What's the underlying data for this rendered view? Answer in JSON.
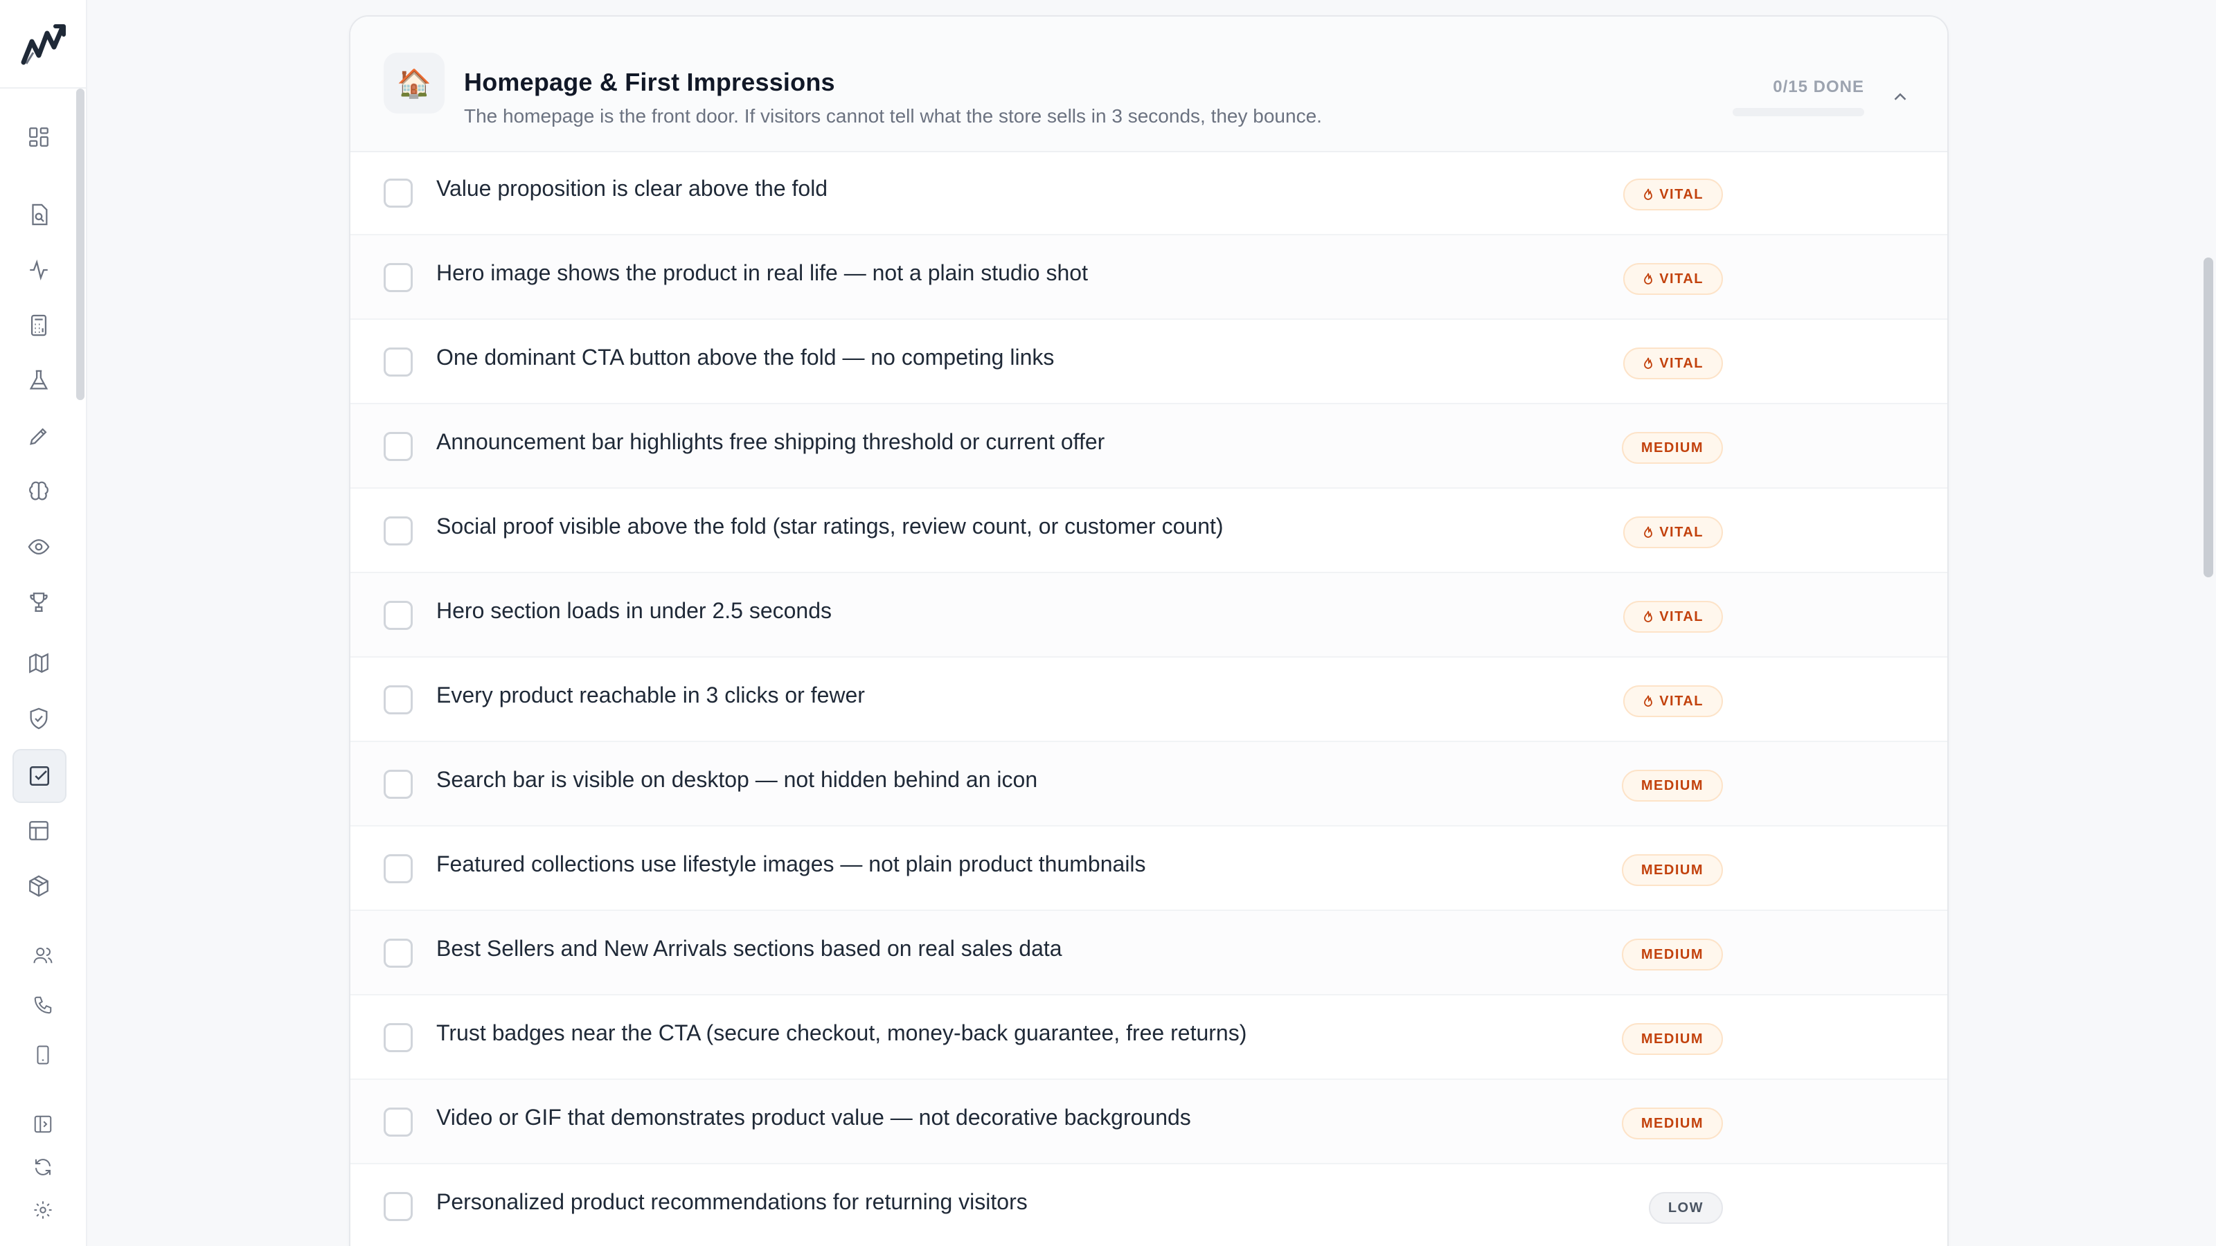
{
  "sidebar": {
    "icons": [
      {
        "name": "dashboard-icon"
      },
      {
        "name": "document-search-icon"
      },
      {
        "name": "activity-icon"
      },
      {
        "name": "calculator-icon"
      },
      {
        "name": "flask-icon"
      },
      {
        "name": "pencil-icon"
      },
      {
        "name": "brain-icon"
      },
      {
        "name": "eye-icon"
      },
      {
        "name": "trophy-icon"
      },
      {
        "name": "map-icon"
      },
      {
        "name": "shield-check-icon"
      },
      {
        "name": "checklist-icon",
        "active": true
      },
      {
        "name": "layout-icon"
      },
      {
        "name": "package-icon"
      },
      {
        "name": "users-icon"
      },
      {
        "name": "phone-icon"
      },
      {
        "name": "smartphone-icon"
      },
      {
        "name": "sidebar-toggle-icon"
      },
      {
        "name": "refresh-icon"
      },
      {
        "name": "settings-icon"
      }
    ]
  },
  "section": {
    "icon": "🏠",
    "title": "Homepage & First Impressions",
    "description": "The homepage is the front door. If visitors cannot tell what the store sells in 3 seconds, they bounce.",
    "progress_text": "0/15 DONE",
    "progress_fraction": 0
  },
  "items": [
    {
      "text": "Value proposition is clear above the fold",
      "priority": "vital",
      "label": "VITAL"
    },
    {
      "text": "Hero image shows the product in real life — not a plain studio shot",
      "priority": "vital",
      "label": "VITAL"
    },
    {
      "text": "One dominant CTA button above the fold — no competing links",
      "priority": "vital",
      "label": "VITAL"
    },
    {
      "text": "Announcement bar highlights free shipping threshold or current offer",
      "priority": "medium",
      "label": "MEDIUM"
    },
    {
      "text": "Social proof visible above the fold (star ratings, review count, or customer count)",
      "priority": "vital",
      "label": "VITAL"
    },
    {
      "text": "Hero section loads in under 2.5 seconds",
      "priority": "vital",
      "label": "VITAL"
    },
    {
      "text": "Every product reachable in 3 clicks or fewer",
      "priority": "vital",
      "label": "VITAL"
    },
    {
      "text": "Search bar is visible on desktop — not hidden behind an icon",
      "priority": "medium",
      "label": "MEDIUM"
    },
    {
      "text": "Featured collections use lifestyle images — not plain product thumbnails",
      "priority": "medium",
      "label": "MEDIUM"
    },
    {
      "text": "Best Sellers and New Arrivals sections based on real sales data",
      "priority": "medium",
      "label": "MEDIUM"
    },
    {
      "text": "Trust badges near the CTA (secure checkout, money-back guarantee, free returns)",
      "priority": "medium",
      "label": "MEDIUM"
    },
    {
      "text": "Video or GIF that demonstrates product value — not decorative backgrounds",
      "priority": "medium",
      "label": "MEDIUM"
    },
    {
      "text": "Personalized product recommendations for returning visitors",
      "priority": "low",
      "label": "LOW"
    }
  ],
  "colors": {
    "accent_badge": "#c2410c",
    "badge_bg": "#fff7ed",
    "low_badge": "#4b5563"
  }
}
